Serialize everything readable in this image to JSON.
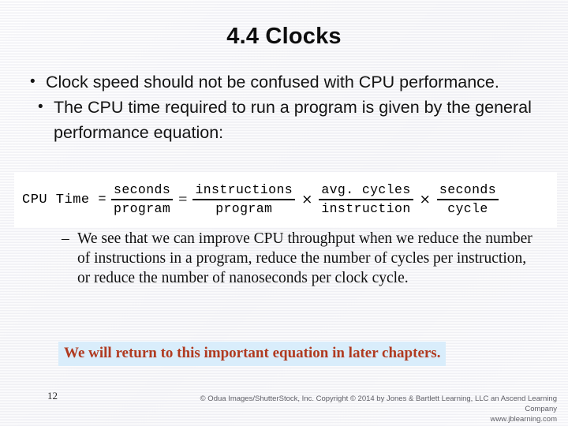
{
  "slide": {
    "title": "4.4 Clocks",
    "page_number": "12",
    "highlight_color": "#d9edfb",
    "accent_red": "#b03a20"
  },
  "bullets": [
    {
      "marker": "•",
      "level": 1,
      "text": "Clock speed should not be confused with CPU performance."
    },
    {
      "marker": "•",
      "level": 2,
      "text": "The CPU time required to run a program is given by the general performance equation:"
    }
  ],
  "formula": {
    "lhs": "CPU Time =",
    "equals": "=",
    "times": "×",
    "terms": [
      {
        "numerator": "seconds",
        "denominator": "program"
      },
      {
        "numerator": "instructions",
        "denominator": "program"
      },
      {
        "numerator": "avg. cycles",
        "denominator": "instruction"
      },
      {
        "numerator": "seconds",
        "denominator": "cycle"
      }
    ]
  },
  "sub_note": {
    "marker": "–",
    "text": "We see that we can improve CPU throughput when we reduce the number of instructions in a program, reduce the number of cycles per instruction, or reduce the number of nanoseconds per clock cycle."
  },
  "callout": {
    "text": "We will return to this important equation in later chapters."
  },
  "footer": {
    "credit_line1": "© Odua Images/ShutterStock, Inc. Copyright © 2014 by Jones & Bartlett Learning, LLC an Ascend Learning Company",
    "credit_line2": "www.jblearning.com"
  }
}
